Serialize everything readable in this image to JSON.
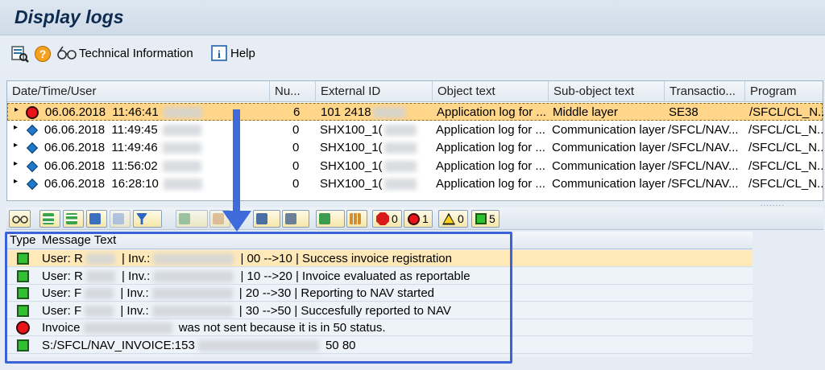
{
  "window": {
    "title": "Display logs"
  },
  "toolbar": {
    "tech_info": "Technical Information",
    "help": "Help"
  },
  "log_table": {
    "columns": [
      "Date/Time/User",
      "Nu...",
      "External ID",
      "Object text",
      "Sub-object text",
      "Transactio...",
      "Program"
    ],
    "rows": [
      {
        "status": "error",
        "date": "06.06.2018",
        "time": "11:46:41",
        "nu": "6",
        "ext_id": "101 2418",
        "object": "Application log for ...",
        "sub": "Middle layer",
        "trans": "SE38",
        "program": "/SFCL/CL_N..."
      },
      {
        "status": "info",
        "date": "06.06.2018",
        "time": "11:49:45",
        "nu": "0",
        "ext_id": "SHX100_1(",
        "object": "Application log for ...",
        "sub": "Communication layer",
        "trans": "/SFCL/NAV...",
        "program": "/SFCL/CL_N..."
      },
      {
        "status": "info",
        "date": "06.06.2018",
        "time": "11:49:46",
        "nu": "0",
        "ext_id": "SHX100_1(",
        "object": "Application log for ...",
        "sub": "Communication layer",
        "trans": "/SFCL/NAV...",
        "program": "/SFCL/CL_N..."
      },
      {
        "status": "info",
        "date": "06.06.2018",
        "time": "11:56:02",
        "nu": "0",
        "ext_id": "SHX100_1(",
        "object": "Application log for ...",
        "sub": "Communication layer",
        "trans": "/SFCL/NAV...",
        "program": "/SFCL/CL_N..."
      },
      {
        "status": "info",
        "date": "06.06.2018",
        "time": "16:28:10",
        "nu": "0",
        "ext_id": "SHX100_1(",
        "object": "Application log for ...",
        "sub": "Communication layer",
        "trans": "/SFCL/NAV...",
        "program": "/SFCL/CL_N..."
      }
    ]
  },
  "msg_toolbar": {
    "stop_count": "0",
    "error_count": "1",
    "warning_count": "0",
    "success_count": "5"
  },
  "messages": {
    "col_type": "Type",
    "col_text": "Message Text",
    "rows": [
      {
        "type": "success",
        "parts": [
          "User: R",
          " | Inv.:",
          " | 00 -->10 | Success invoice registration"
        ]
      },
      {
        "type": "success",
        "parts": [
          "User: R",
          " | Inv.:",
          " | 10 -->20 | Invoice evaluated as reportable"
        ]
      },
      {
        "type": "success",
        "parts": [
          "User: F",
          " | Inv.:",
          " | 20 -->30 | Reporting to NAV started"
        ]
      },
      {
        "type": "success",
        "parts": [
          "User: F",
          " | Inv.:",
          " | 30 -->50 | Succesfully reported to NAV"
        ]
      },
      {
        "type": "error",
        "parts": [
          "Invoice",
          " was not sent because it is in 50 status.",
          ""
        ]
      },
      {
        "type": "success",
        "parts": [
          "S:/SFCL/NAV_INVOICE:153",
          " 50 80",
          ""
        ]
      }
    ]
  },
  "colors": {
    "highlight": "#ffd68a",
    "frame": "#3a63d8",
    "success": "#2fc12f",
    "error": "#e8141a",
    "info": "#1f78c8"
  }
}
